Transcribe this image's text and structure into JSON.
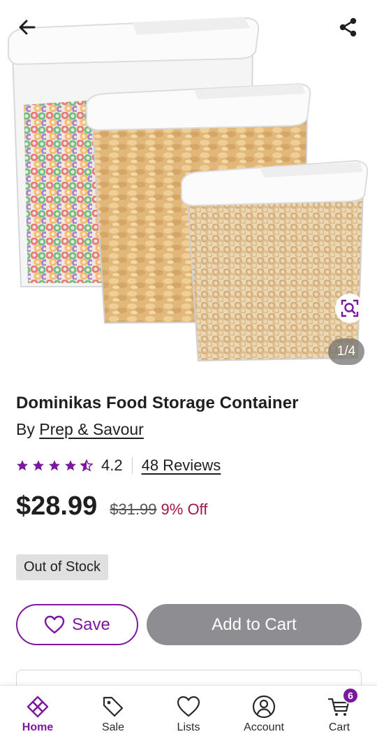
{
  "hero": {
    "pager_text": "1/4"
  },
  "product": {
    "title": "Dominikas Food Storage Container",
    "by_prefix": "By ",
    "brand": "Prep & Savour",
    "rating_value": "4.2",
    "rating_stars": 4.5,
    "reviews_link": "48 Reviews",
    "price": "$28.99",
    "old_price": "$31.99",
    "discount": "9% Off",
    "stock_status": "Out of Stock"
  },
  "actions": {
    "save_label": "Save",
    "add_to_cart_label": "Add to Cart"
  },
  "nav": {
    "items": [
      {
        "label": "Home",
        "icon": "home-icon",
        "active": true
      },
      {
        "label": "Sale",
        "icon": "tag-icon",
        "active": false
      },
      {
        "label": "Lists",
        "icon": "heart-icon",
        "active": false
      },
      {
        "label": "Account",
        "icon": "account-icon",
        "active": false
      },
      {
        "label": "Cart",
        "icon": "cart-icon",
        "active": false
      }
    ],
    "cart_count": "6"
  },
  "colors": {
    "brand": "#7b189f",
    "discount": "#a3154a",
    "disabled_button": "#8e8d91"
  }
}
